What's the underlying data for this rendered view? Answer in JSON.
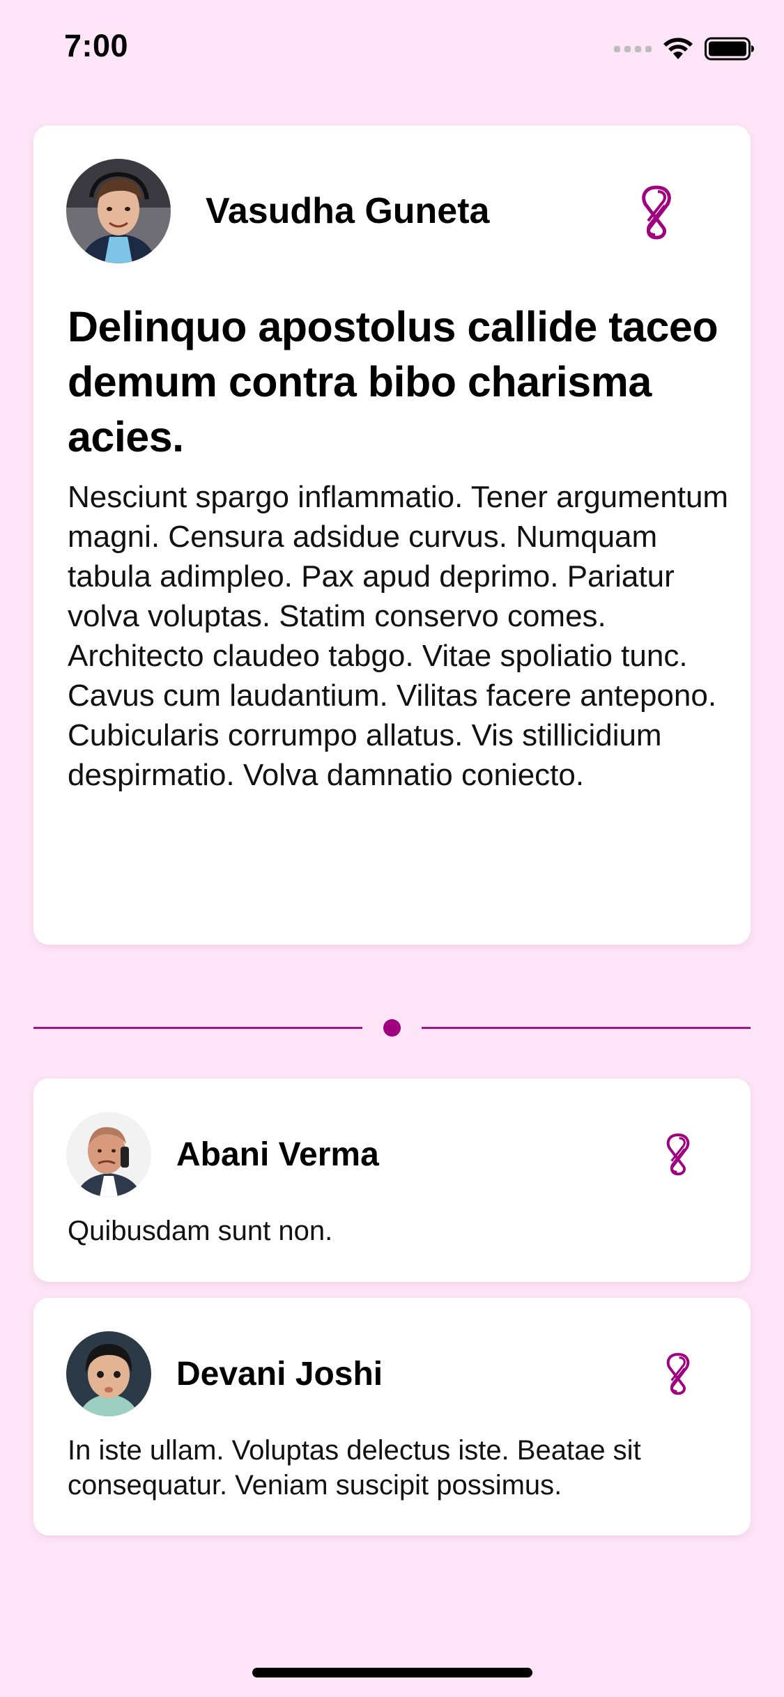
{
  "status_bar": {
    "time": "7:00"
  },
  "colors": {
    "background": "#FDE4F6",
    "accent": "#A0007F",
    "card": "#FFFFFF"
  },
  "featured_post": {
    "author": "Vasudha Guneta",
    "avatar_icon": "person-avatar",
    "brand_icon": "linked-loops-icon",
    "headline": "Delinquo apostolus callide taceo demum contra bibo charisma acies.",
    "body": "Nesciunt spargo inflammatio. Tener argumentum magni. Censura adsidue curvus. Numquam tabula adimpleo. Pax apud deprimo. Pariatur volva voluptas. Statim conservo comes. Architecto claudeo tabgo. Vitae spoliatio tunc. Cavus cum laudantium. Vilitas facere antepono. Cubicularis corrumpo allatus. Vis stillicidium despirmatio. Volva damnatio coniecto."
  },
  "comments": [
    {
      "author": "Abani Verma",
      "text": "Quibusdam sunt non."
    },
    {
      "author": "Devani Joshi",
      "text": "In iste ullam. Voluptas delectus iste. Beatae sit consequatur. Veniam suscipit possimus."
    }
  ]
}
